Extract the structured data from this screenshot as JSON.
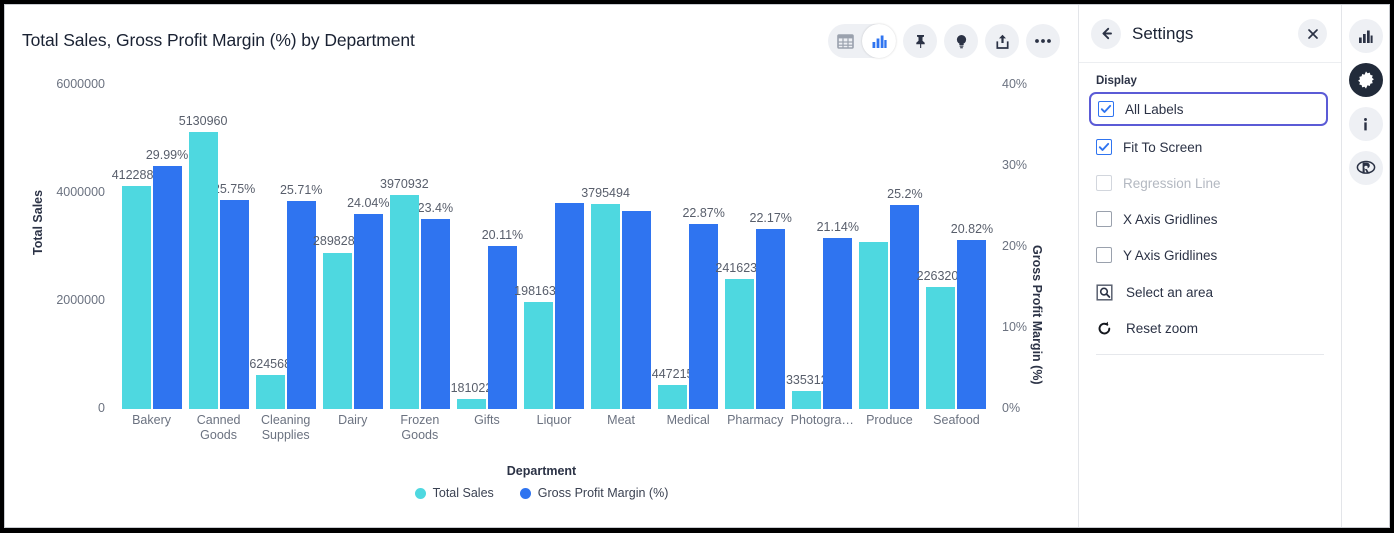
{
  "chart": {
    "title": "Total Sales, Gross Profit Margin (%) by Department",
    "toolbar": [
      {
        "name": "table-view-icon",
        "label": "Table view"
      },
      {
        "name": "chart-view-icon",
        "label": "Chart view"
      },
      {
        "name": "pin-icon",
        "label": "Pin"
      },
      {
        "name": "insights-bulb-icon",
        "label": "Insights"
      },
      {
        "name": "share-icon",
        "label": "Share"
      },
      {
        "name": "more-options-icon",
        "label": "More options"
      }
    ]
  },
  "chart_data": {
    "type": "bar",
    "title": "Total Sales, Gross Profit Margin (%) by Department",
    "xlabel": "Department",
    "ylabel": "Total Sales",
    "y2label": "Gross Profit Margin (%)",
    "ylim": [
      0,
      6000000
    ],
    "y2lim": [
      0,
      40
    ],
    "yticks": [
      "0",
      "2000000",
      "4000000",
      "6000000"
    ],
    "y2ticks": [
      "0%",
      "10%",
      "20%",
      "30%",
      "40%"
    ],
    "grid": false,
    "legend_position": "bottom",
    "categories": [
      "Bakery",
      "Canned\nGoods",
      "Cleaning\nSupplies",
      "Dairy",
      "Frozen\nGoods",
      "Gifts",
      "Liquor",
      "Meat",
      "Medical",
      "Pharmacy",
      "Photogra…",
      "Produce",
      "Seafood"
    ],
    "series": [
      {
        "name": "Total Sales",
        "color": "#4ed8e0",
        "axis": "left",
        "values": [
          4122881,
          5130960,
          624568,
          2898285,
          3970932,
          181022,
          1981634,
          3795494,
          447215,
          2416230,
          335312,
          3090000,
          2263205
        ],
        "labels": [
          "4122881",
          "5130960",
          "624568",
          "2898285",
          "3970932",
          "181022",
          "1981634",
          "3795494",
          "447215",
          "2416230",
          "335312",
          "",
          "2263205"
        ]
      },
      {
        "name": "Gross Profit Margin (%)",
        "color": "#2f74f0",
        "axis": "right",
        "values": [
          29.99,
          25.75,
          25.71,
          24.04,
          23.4,
          20.11,
          25.4,
          24.5,
          22.87,
          22.17,
          21.14,
          25.2,
          20.82
        ],
        "labels": [
          "29.99%",
          "25.75%",
          "25.71%",
          "24.04%",
          "23.4%",
          "20.11%",
          "",
          "",
          "22.87%",
          "22.17%",
          "21.14%",
          "25.2%",
          "20.82%"
        ]
      }
    ]
  },
  "settings": {
    "title": "Settings",
    "section_label": "Display",
    "options": [
      {
        "label": "All Labels",
        "checked": true,
        "disabled": false,
        "focused": true
      },
      {
        "label": "Fit To Screen",
        "checked": true,
        "disabled": false,
        "focused": false
      },
      {
        "label": "Regression Line",
        "checked": false,
        "disabled": true,
        "focused": false
      },
      {
        "label": "X Axis Gridlines",
        "checked": false,
        "disabled": false,
        "focused": false
      },
      {
        "label": "Y Axis Gridlines",
        "checked": false,
        "disabled": false,
        "focused": false
      }
    ],
    "actions": [
      {
        "label": "Select an area",
        "icon": "select-area-icon"
      },
      {
        "label": "Reset zoom",
        "icon": "reset-zoom-icon"
      }
    ]
  },
  "rail": [
    {
      "name": "rail-chart-icon",
      "label": "Chart",
      "active": false
    },
    {
      "name": "rail-settings-gear-icon",
      "label": "Settings",
      "active": true
    },
    {
      "name": "rail-info-icon",
      "label": "Info",
      "active": false
    },
    {
      "name": "rail-r-logo-icon",
      "label": "R",
      "active": false
    }
  ],
  "colors": {
    "series1": "#4ed8e0",
    "series2": "#2f74f0",
    "focus_ring": "#5b5bd6"
  }
}
